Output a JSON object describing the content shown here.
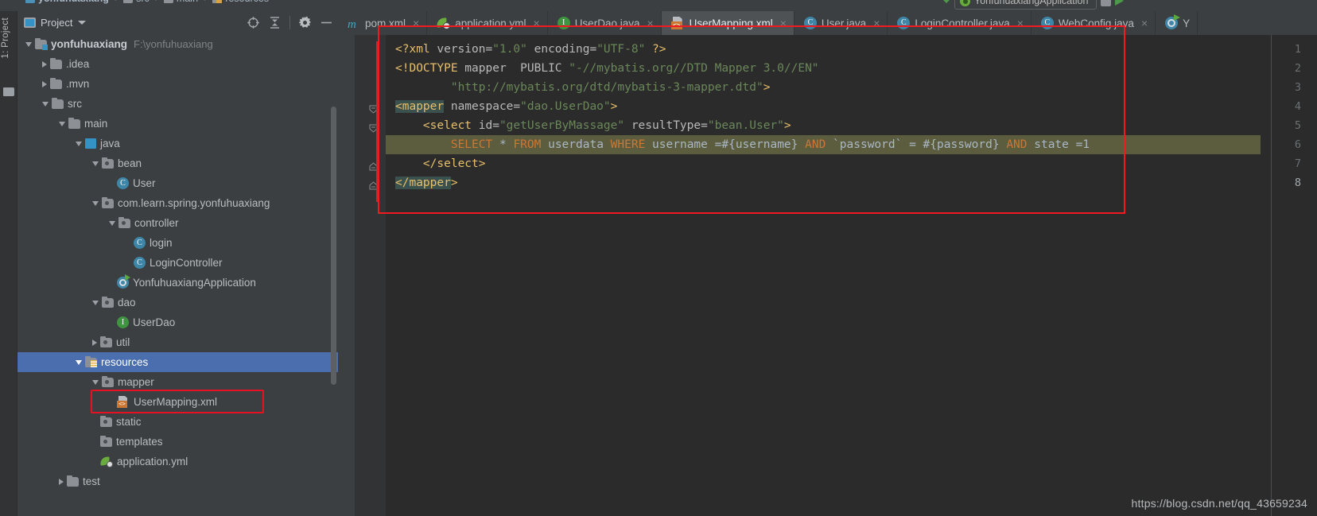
{
  "breadcrumb": {
    "items": [
      "yonfuhuaxiang",
      "src",
      "main",
      "resources"
    ],
    "separator": "›"
  },
  "run_config": {
    "name": "YonfuhuaxiangApplication"
  },
  "tool_stripe": {
    "label": "1: Project",
    "folder_icon": "folder-icon"
  },
  "project_panel": {
    "title": "Project",
    "icons": [
      "locate-target-icon",
      "collapse-all-icon",
      "gear-icon",
      "minimize-icon"
    ],
    "tree": [
      {
        "id": "yonfuhuaxiang",
        "label": "yonfuhuaxiang",
        "hint": "F:\\yonfuhuaxiang",
        "indent": 0,
        "arrow": "expanded",
        "icon": "module-folder-icon",
        "bold": true,
        "selected": false
      },
      {
        "id": "idea",
        "label": ".idea",
        "hint": "",
        "indent": 1,
        "arrow": "collapsed",
        "icon": "folder-icon",
        "bold": false,
        "selected": false
      },
      {
        "id": "mvn",
        "label": ".mvn",
        "hint": "",
        "indent": 1,
        "arrow": "collapsed",
        "icon": "folder-icon",
        "bold": false,
        "selected": false
      },
      {
        "id": "src",
        "label": "src",
        "hint": "",
        "indent": 1,
        "arrow": "expanded",
        "icon": "folder-icon",
        "bold": false,
        "selected": false
      },
      {
        "id": "main",
        "label": "main",
        "hint": "",
        "indent": 2,
        "arrow": "expanded",
        "icon": "folder-icon",
        "bold": false,
        "selected": false
      },
      {
        "id": "java",
        "label": "java",
        "hint": "",
        "indent": 3,
        "arrow": "expanded",
        "icon": "source-root-icon",
        "bold": false,
        "selected": false
      },
      {
        "id": "bean",
        "label": "bean",
        "hint": "",
        "indent": 4,
        "arrow": "expanded",
        "icon": "package-icon",
        "bold": false,
        "selected": false
      },
      {
        "id": "User",
        "label": "User",
        "hint": "",
        "indent": 5,
        "arrow": "none",
        "icon": "java-class-icon",
        "bold": false,
        "selected": false
      },
      {
        "id": "compkg",
        "label": "com.learn.spring.yonfuhuaxiang",
        "hint": "",
        "indent": 4,
        "arrow": "expanded",
        "icon": "package-icon",
        "bold": false,
        "selected": false
      },
      {
        "id": "controller",
        "label": "controller",
        "hint": "",
        "indent": 5,
        "arrow": "expanded",
        "icon": "package-icon",
        "bold": false,
        "selected": false
      },
      {
        "id": "login",
        "label": "login",
        "hint": "",
        "indent": 6,
        "arrow": "none",
        "icon": "java-class-icon",
        "bold": false,
        "selected": false
      },
      {
        "id": "LoginController",
        "label": "LoginController",
        "hint": "",
        "indent": 6,
        "arrow": "none",
        "icon": "java-class-icon",
        "bold": false,
        "selected": false
      },
      {
        "id": "YonfuhuaxiangApplication",
        "label": "YonfuhuaxiangApplication",
        "hint": "",
        "indent": 5,
        "arrow": "none",
        "icon": "spring-app-icon",
        "bold": false,
        "selected": false
      },
      {
        "id": "dao",
        "label": "dao",
        "hint": "",
        "indent": 4,
        "arrow": "expanded",
        "icon": "package-icon",
        "bold": false,
        "selected": false
      },
      {
        "id": "UserDao",
        "label": "UserDao",
        "hint": "",
        "indent": 5,
        "arrow": "none",
        "icon": "java-interface-icon",
        "bold": false,
        "selected": false
      },
      {
        "id": "util",
        "label": "util",
        "hint": "",
        "indent": 4,
        "arrow": "collapsed",
        "icon": "package-icon",
        "bold": false,
        "selected": false
      },
      {
        "id": "resources",
        "label": "resources",
        "hint": "",
        "indent": 3,
        "arrow": "expanded",
        "icon": "resources-folder-icon",
        "bold": false,
        "selected": true
      },
      {
        "id": "mapper",
        "label": "mapper",
        "hint": "",
        "indent": 4,
        "arrow": "expanded",
        "icon": "package-icon",
        "bold": false,
        "selected": false
      },
      {
        "id": "UserMapping.xml",
        "label": "UserMapping.xml",
        "hint": "",
        "indent": 5,
        "arrow": "none",
        "icon": "xml-mapping-icon",
        "bold": false,
        "selected": false,
        "highlight_box": true
      },
      {
        "id": "static",
        "label": "static",
        "hint": "",
        "indent": 4,
        "arrow": "none",
        "icon": "package-icon",
        "bold": false,
        "selected": false
      },
      {
        "id": "templates",
        "label": "templates",
        "hint": "",
        "indent": 4,
        "arrow": "none",
        "icon": "package-icon",
        "bold": false,
        "selected": false
      },
      {
        "id": "application.yml",
        "label": "application.yml",
        "hint": "",
        "indent": 4,
        "arrow": "none",
        "icon": "yml-icon",
        "bold": false,
        "selected": false
      },
      {
        "id": "test",
        "label": "test",
        "hint": "",
        "indent": 2,
        "arrow": "collapsed",
        "icon": "folder-icon",
        "bold": false,
        "selected": false
      }
    ]
  },
  "editor": {
    "tabs": [
      {
        "id": "pom",
        "label": "pom.xml",
        "icon": "maven-icon",
        "active": false,
        "close": "×"
      },
      {
        "id": "appyml",
        "label": "application.yml",
        "icon": "yml-icon",
        "active": false,
        "close": "×"
      },
      {
        "id": "userdao",
        "label": "UserDao.java",
        "icon": "java-interface-icon",
        "active": false,
        "close": "×"
      },
      {
        "id": "usermap",
        "label": "UserMapping.xml",
        "icon": "xml-mapping-icon",
        "active": true,
        "close": "×"
      },
      {
        "id": "user",
        "label": "User.java",
        "icon": "java-class-icon",
        "active": false,
        "close": "×"
      },
      {
        "id": "logincon",
        "label": "LoginController.java",
        "icon": "java-class-icon",
        "active": false,
        "close": "×"
      },
      {
        "id": "webconfig",
        "label": "WebConfig.java",
        "icon": "java-class-icon",
        "active": false,
        "close": "×"
      },
      {
        "id": "yonfuapp",
        "label": "Y",
        "icon": "spring-app-icon",
        "active": false,
        "close": ""
      }
    ],
    "line_numbers": [
      "1",
      "2",
      "3",
      "4",
      "5",
      "6",
      "7",
      "8"
    ],
    "current_line": 8,
    "lines": [
      {
        "n": 1,
        "tokens": [
          {
            "t": "<?xml ",
            "c": "t-doct"
          },
          {
            "t": "version=",
            "c": "t-attrn"
          },
          {
            "t": "\"1.0\"",
            "c": "t-str"
          },
          {
            "t": " encoding=",
            "c": "t-attrn"
          },
          {
            "t": "\"UTF-8\"",
            "c": "t-str"
          },
          {
            "t": " ?>",
            "c": "t-doct"
          }
        ]
      },
      {
        "n": 2,
        "tokens": [
          {
            "t": "<!DOCTYPE",
            "c": "t-doct"
          },
          {
            "t": " mapper  PUBLIC ",
            "c": "t-attrn"
          },
          {
            "t": "\"-//mybatis.org//DTD Mapper 3.0//EN\"",
            "c": "t-str"
          }
        ]
      },
      {
        "n": 3,
        "tokens": [
          {
            "t": "        ",
            "c": "t-plain"
          },
          {
            "t": "\"http://mybatis.org/dtd/mybatis-3-mapper.dtd\"",
            "c": "t-str"
          },
          {
            "t": ">",
            "c": "t-doct"
          }
        ]
      },
      {
        "n": 4,
        "tokens": [
          {
            "t": "<mapper",
            "c": "t-tag hl-match"
          },
          {
            "t": " namespace=",
            "c": "t-attrn"
          },
          {
            "t": "\"dao.UserDao\"",
            "c": "t-str"
          },
          {
            "t": ">",
            "c": "t-tag"
          }
        ]
      },
      {
        "n": 5,
        "tokens": [
          {
            "t": "    ",
            "c": "t-plain"
          },
          {
            "t": "<select",
            "c": "t-tag"
          },
          {
            "t": " id=",
            "c": "t-attrn"
          },
          {
            "t": "\"getUserByMassage\"",
            "c": "t-str"
          },
          {
            "t": " resultType=",
            "c": "t-attrn"
          },
          {
            "t": "\"bean.User\"",
            "c": "t-str"
          },
          {
            "t": ">",
            "c": "t-tag"
          }
        ]
      },
      {
        "n": 6,
        "tokens": [
          {
            "t": "        ",
            "c": "t-plain"
          },
          {
            "t": "SELECT",
            "c": "t-kw"
          },
          {
            "t": " * ",
            "c": "t-plain"
          },
          {
            "t": "FROM",
            "c": "t-kw"
          },
          {
            "t": " userdata ",
            "c": "t-plain"
          },
          {
            "t": "WHERE",
            "c": "t-kw"
          },
          {
            "t": " username =#{username} ",
            "c": "t-plain"
          },
          {
            "t": "AND",
            "c": "t-kw"
          },
          {
            "t": " `password` = #{password} ",
            "c": "t-plain"
          },
          {
            "t": "AND",
            "c": "t-kw"
          },
          {
            "t": " state =1",
            "c": "t-plain"
          }
        ]
      },
      {
        "n": 7,
        "tokens": [
          {
            "t": "    ",
            "c": "t-plain"
          },
          {
            "t": "</select>",
            "c": "t-tag"
          }
        ]
      },
      {
        "n": 8,
        "tokens": [
          {
            "t": "</mapper",
            "c": "t-tag hl-match"
          },
          {
            "t": ">",
            "c": "t-tag"
          }
        ]
      }
    ]
  },
  "watermark": "https://blog.csdn.net/qq_43659234",
  "colors": {
    "selection_blue": "#4b6eaf",
    "annotation_red": "#f01a23",
    "sql_band": "#5c5c3e",
    "editor_bg": "#2b2b2b",
    "panel_bg": "#3c3f41"
  }
}
